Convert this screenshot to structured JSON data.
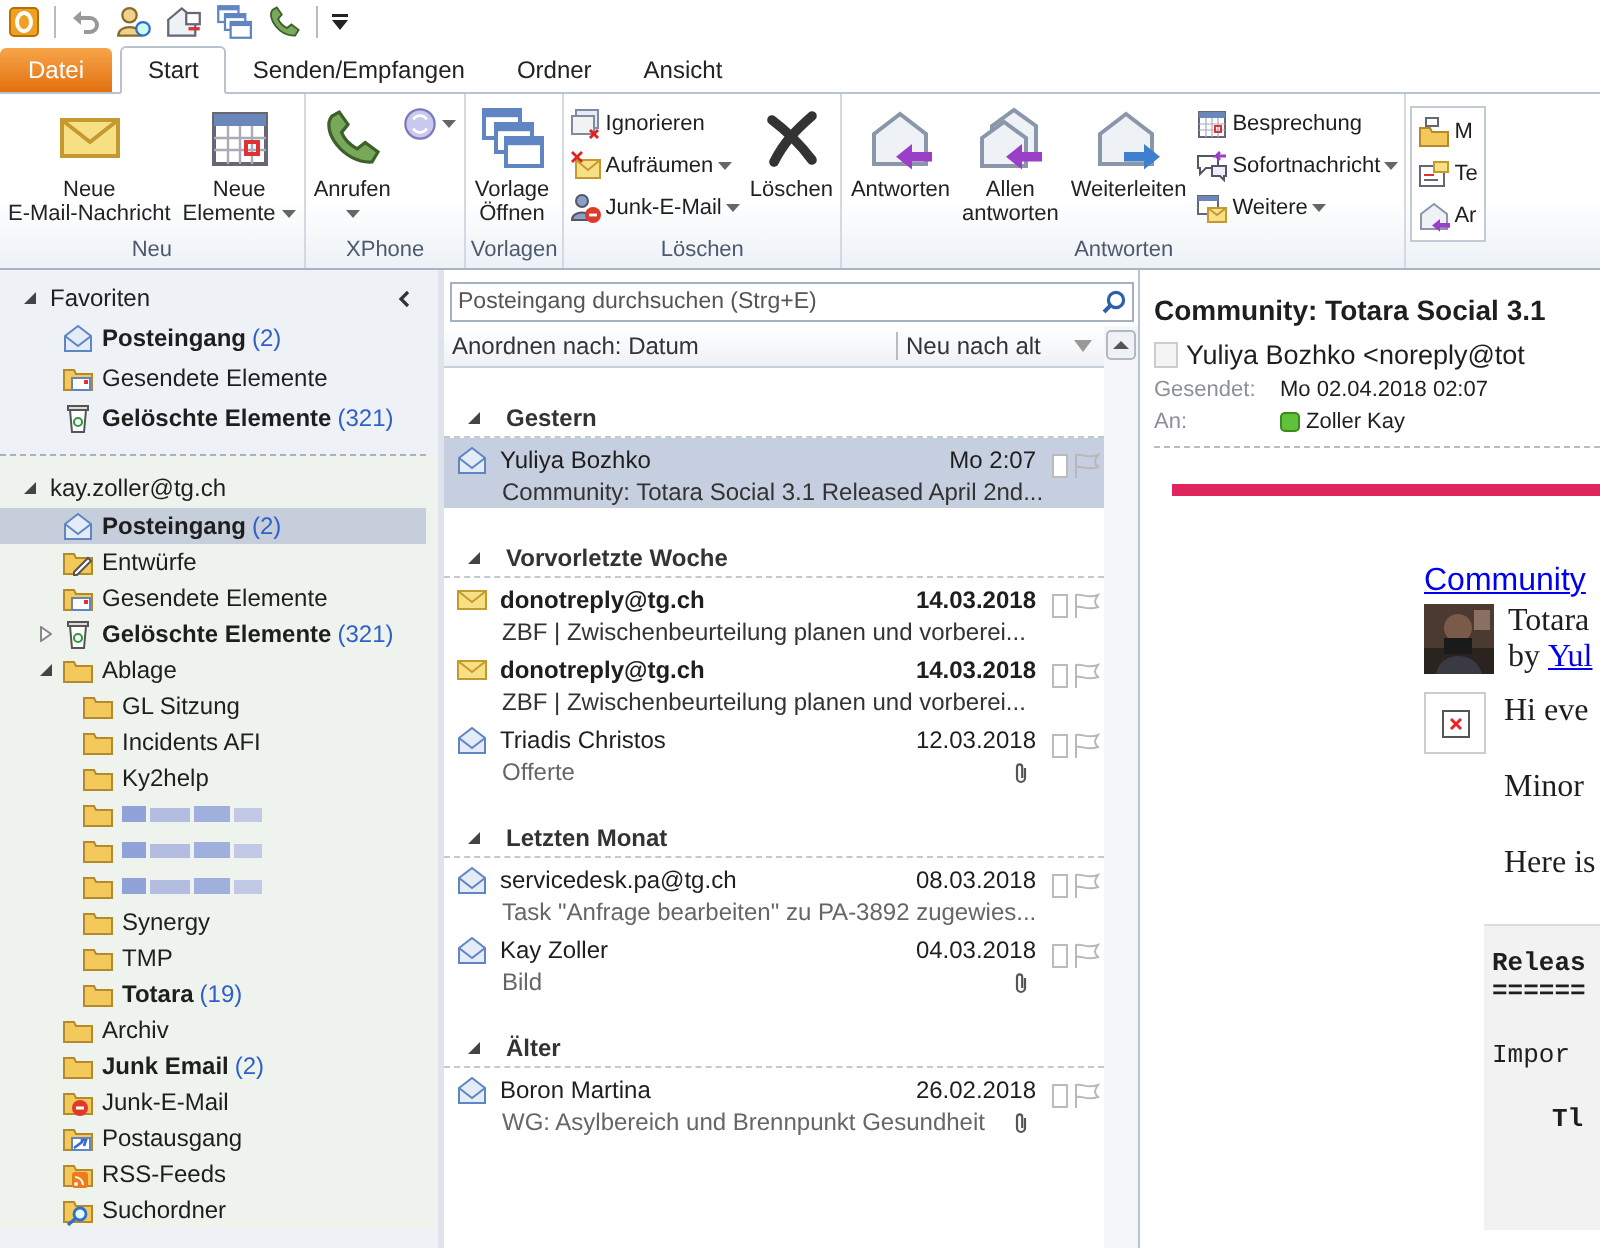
{
  "tabs": [
    {
      "label": "Datei",
      "kind": "file",
      "selected": false
    },
    {
      "label": "Start",
      "kind": "tab",
      "selected": true
    },
    {
      "label": "Senden/Empfangen",
      "kind": "tab",
      "selected": false
    },
    {
      "label": "Ordner",
      "kind": "tab",
      "selected": false
    },
    {
      "label": "Ansicht",
      "kind": "tab",
      "selected": false
    }
  ],
  "ribbon": {
    "groups": [
      {
        "label": "Neu",
        "items": [
          {
            "kind": "large",
            "label": "Neue\nE-Mail-Nachricht",
            "dropdown": false
          },
          {
            "kind": "large",
            "label": "Neue\nElemente",
            "dropdown": true
          }
        ]
      },
      {
        "label": "XPhone",
        "items": [
          {
            "kind": "large",
            "label": "Anrufen",
            "dropdown": true
          },
          {
            "kind": "icon",
            "dropdown": true
          }
        ]
      },
      {
        "label": "Vorlagen",
        "items": [
          {
            "kind": "large",
            "label": "Vorlage\nÖffnen",
            "dropdown": false
          }
        ]
      },
      {
        "label": "Löschen",
        "items": [
          {
            "kind": "stack",
            "buttons": [
              {
                "label": "Ignorieren",
                "dropdown": false
              },
              {
                "label": "Aufräumen",
                "dropdown": true
              },
              {
                "label": "Junk-E-Mail",
                "dropdown": true
              }
            ]
          },
          {
            "kind": "large",
            "label": "Löschen",
            "dropdown": false
          }
        ]
      },
      {
        "label": "Antworten",
        "items": [
          {
            "kind": "large",
            "label": "Antworten",
            "dropdown": false
          },
          {
            "kind": "large",
            "label": "Allen\nantworten",
            "dropdown": false
          },
          {
            "kind": "large",
            "label": "Weiterleiten",
            "dropdown": false
          },
          {
            "kind": "stack",
            "buttons": [
              {
                "label": "Besprechung",
                "dropdown": false
              },
              {
                "label": "Sofortnachricht",
                "dropdown": true
              },
              {
                "label": "Weitere",
                "dropdown": true
              }
            ]
          }
        ]
      },
      {
        "items": [
          {
            "kind": "boxed",
            "buttons": [
              {
                "label": "M",
                "dropdown": false
              },
              {
                "label": "Te",
                "dropdown": false
              },
              {
                "label": "Ar",
                "dropdown": false
              }
            ]
          }
        ]
      }
    ]
  },
  "sidebar": {
    "sections": [
      {
        "title": "Favoriten",
        "expanded": true,
        "folders": [
          {
            "name": "Posteingang",
            "count": "(2)",
            "unread": true,
            "selected": false
          },
          {
            "name": "Gesendete Elemente",
            "unread": false,
            "selected": false
          },
          {
            "name": "Gelöschte Elemente",
            "count": "(321)",
            "unread": true,
            "selected": false
          }
        ]
      },
      {
        "title": "kay.zoller@tg.ch",
        "expanded": true,
        "folders": [
          {
            "name": "Posteingang",
            "count": "(2)",
            "unread": true,
            "selected": true
          },
          {
            "name": "Entwürfe",
            "unread": false,
            "selected": false
          },
          {
            "name": "Gesendete Elemente",
            "unread": false,
            "selected": false
          },
          {
            "name": "Gelöschte Elemente",
            "count": "(321)",
            "unread": true,
            "selected": false,
            "expanded": false
          },
          {
            "name": "Ablage",
            "unread": false,
            "selected": false,
            "expanded": true,
            "children": [
              {
                "name": "GL Sitzung",
                "unread": false,
                "selected": false
              },
              {
                "name": "Incidents AFI",
                "unread": false,
                "selected": false
              },
              {
                "name": "Ky2help",
                "unread": false,
                "selected": false
              },
              {
                "kind": "redacted",
                "selected": false
              },
              {
                "kind": "redacted",
                "selected": false
              },
              {
                "kind": "redacted",
                "selected": false
              },
              {
                "name": "Synergy",
                "unread": false,
                "selected": false
              },
              {
                "name": "TMP",
                "unread": false,
                "selected": false
              },
              {
                "name": "Totara",
                "count": "(19)",
                "unread": true,
                "selected": false
              }
            ]
          },
          {
            "name": "Archiv",
            "unread": false,
            "selected": false
          },
          {
            "name": "Junk Email",
            "count": "(2)",
            "unread": true,
            "selected": false
          },
          {
            "name": "Junk-E-Mail",
            "unread": false,
            "selected": false
          },
          {
            "name": "Postausgang",
            "unread": false,
            "selected": false
          },
          {
            "name": "RSS-Feeds",
            "unread": false,
            "selected": false
          },
          {
            "name": "Suchordner",
            "unread": false,
            "selected": false
          }
        ]
      }
    ]
  },
  "message_list": {
    "search": {
      "placeholder": "Posteingang durchsuchen (Strg+E)"
    },
    "arrange_label": "Anordnen nach: Datum",
    "order_label": "Neu nach alt",
    "groups": [
      {
        "title": "Gestern",
        "expanded": true,
        "messages": [
          {
            "sender": "Yuliya Bozhko",
            "date": "Mo 2:07",
            "subject": "Community: Totara Social 3.1 Released April 2nd...",
            "unread": false,
            "selected": true,
            "attachment": false
          }
        ]
      },
      {
        "title": "Vorvorletzte Woche",
        "expanded": true,
        "messages": [
          {
            "sender": "donotreply@tg.ch",
            "date": "14.03.2018",
            "subject": "ZBF | Zwischenbeurteilung planen und vorberei...",
            "unread": true,
            "selected": false,
            "attachment": false
          },
          {
            "sender": "donotreply@tg.ch",
            "date": "14.03.2018",
            "subject": "ZBF | Zwischenbeurteilung planen und vorberei...",
            "unread": true,
            "selected": false,
            "attachment": false
          },
          {
            "sender": "Triadis Christos",
            "date": "12.03.2018",
            "subject": "Offerte",
            "unread": false,
            "selected": false,
            "attachment": true
          }
        ]
      },
      {
        "title": "Letzten Monat",
        "expanded": true,
        "messages": [
          {
            "sender": "servicedesk.pa@tg.ch",
            "date": "08.03.2018",
            "subject": "Task \"Anfrage bearbeiten\" zu PA-3892 zugewies...",
            "unread": false,
            "selected": false,
            "attachment": false
          },
          {
            "sender": "Kay Zoller",
            "date": "04.03.2018",
            "subject": "Bild",
            "unread": false,
            "selected": false,
            "attachment": true
          }
        ]
      },
      {
        "title": "Älter",
        "expanded": true,
        "messages": [
          {
            "sender": "Boron Martina",
            "date": "26.02.2018",
            "subject": "WG: Asylbereich und Brennpunkt Gesundheit",
            "unread": false,
            "selected": false,
            "attachment": true
          }
        ]
      }
    ]
  },
  "reading_pane": {
    "subject": "Community: Totara Social 3.1",
    "sender": "Yuliya Bozhko <noreply@tot",
    "fields": [
      {
        "label": "Gesendet:",
        "value": "Mo 02.04.2018 02:07"
      },
      {
        "label": "An:",
        "value": "Zoller Kay",
        "presence": true
      }
    ],
    "body": {
      "heading_link": "Community",
      "post_title": "Totara",
      "byline": "by",
      "author_link": "Yul",
      "paragraphs": [
        "Hi eve",
        "Minor",
        "Here is"
      ],
      "code_blocks": [
        [
          "Releas",
          "======"
        ],
        [
          "Impor"
        ],
        [
          "Tl"
        ]
      ]
    }
  }
}
